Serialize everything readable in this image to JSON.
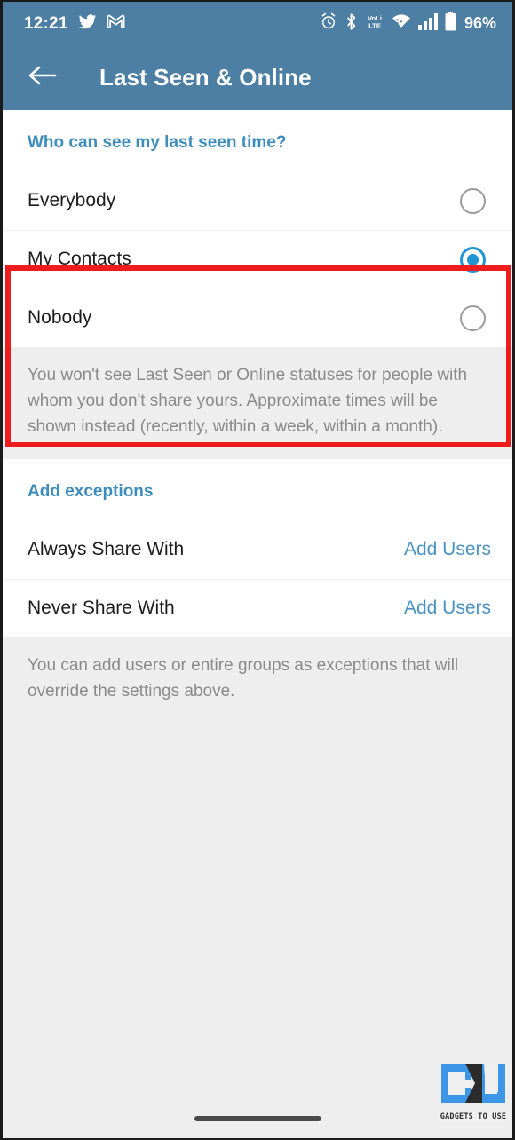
{
  "status_bar": {
    "time": "12:21",
    "left_icons": [
      "twitter-icon",
      "gmail-icon"
    ],
    "right_icons": [
      "alarm-icon",
      "bluetooth-icon",
      "volte-icon",
      "wifi-icon",
      "cellular-signal-icon",
      "battery-icon"
    ],
    "battery_percent": "96%",
    "background_color": "#4d7ea3"
  },
  "app_bar": {
    "back_icon": "arrow-left-icon",
    "title": "Last Seen & Online",
    "background_color": "#4d7ea3"
  },
  "last_seen_section": {
    "header": "Who can see my last seen time?",
    "options": [
      {
        "label": "Everybody",
        "selected": false
      },
      {
        "label": "My Contacts",
        "selected": true
      },
      {
        "label": "Nobody",
        "selected": false
      }
    ],
    "note": "You won't see Last Seen or Online statuses for people with whom you don't share yours. Approximate times will be shown instead (recently, within a week, within a month)."
  },
  "exceptions_section": {
    "header": "Add exceptions",
    "rows": [
      {
        "label": "Always Share With",
        "action": "Add Users"
      },
      {
        "label": "Never Share With",
        "action": "Add Users"
      }
    ],
    "note": "You can add users or entire groups as exceptions that will override the settings above."
  },
  "annotation": {
    "type": "red-highlight-rectangle",
    "color": "#ee1c1c"
  },
  "watermark": {
    "logo": "gu-monogram-logo",
    "text": "GADGETS TO USE"
  },
  "colors": {
    "accent_blue": "#3c8dbc",
    "link_blue": "#4a93c4",
    "radio_selected": "#2196d3",
    "page_background": "#eeeeee"
  }
}
